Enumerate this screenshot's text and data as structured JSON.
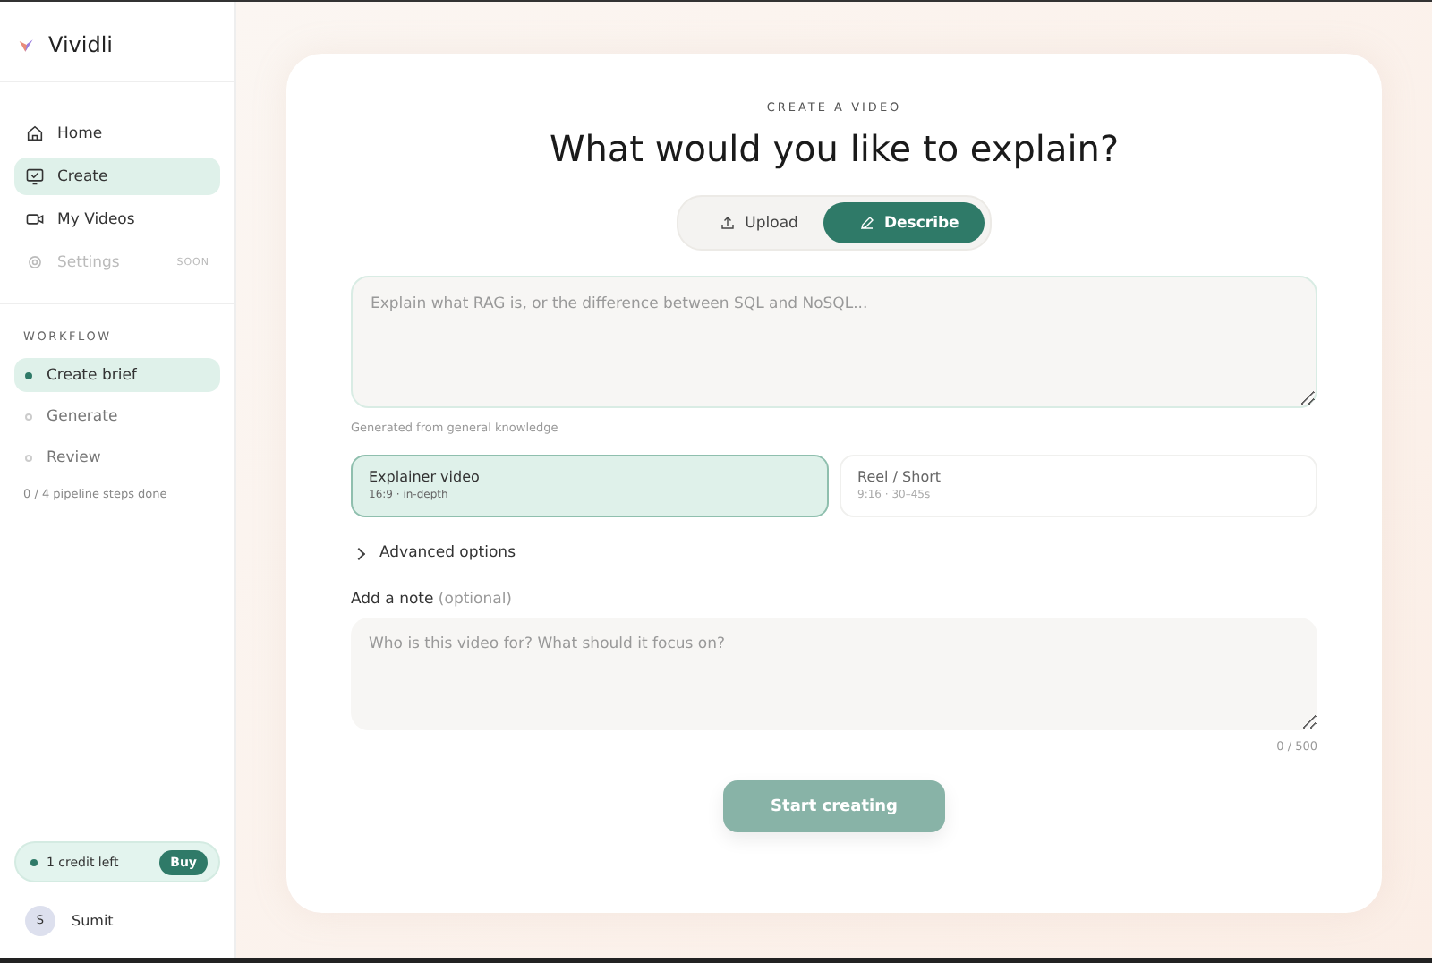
{
  "sidebar": {
    "brand": "Vividli",
    "nav": [
      {
        "label": "Home",
        "kind": "home",
        "selected": false,
        "disabled": false
      },
      {
        "label": "Create",
        "kind": "create",
        "selected": true,
        "disabled": false
      },
      {
        "label": "My Videos",
        "kind": "video",
        "selected": false,
        "disabled": false
      },
      {
        "label": "Settings",
        "kind": "settings",
        "selected": false,
        "disabled": true,
        "badge": "SOON"
      }
    ],
    "workflow_title": "WORKFLOW",
    "steps": [
      {
        "label": "Create brief",
        "selected": true
      },
      {
        "label": "Generate",
        "selected": false
      },
      {
        "label": "Review",
        "selected": false
      }
    ],
    "progress": "0 / 4 pipeline steps done",
    "credits": {
      "text": "1 credit left",
      "button": "Buy"
    },
    "user": {
      "initial": "S",
      "name": "Sumit"
    }
  },
  "main": {
    "eyebrow": "CREATE A VIDEO",
    "title": "What would you like to explain?",
    "modes": [
      {
        "label": "Upload",
        "kind": "upload",
        "selected": false
      },
      {
        "label": "Describe",
        "kind": "describe",
        "selected": true
      }
    ],
    "prompt": {
      "placeholder": "Explain what RAG is, or the difference between SQL and NoSQL..."
    },
    "hint": "Generated from general knowledge",
    "formats": [
      {
        "title": "Explainer video",
        "detail": "16:9 · in-depth",
        "selected": true
      },
      {
        "title": "Reel / Short",
        "detail": "9:16 · 30–45s",
        "selected": false
      }
    ],
    "advanced": {
      "label": "Advanced options",
      "expanded": false
    },
    "note_label": "Add a note *(optional)*",
    "note": {
      "placeholder": "Who is this video for? What should it focus on?"
    },
    "counter": "0 / 500",
    "submit": {
      "label": "Start creating",
      "disabled": true
    }
  }
}
